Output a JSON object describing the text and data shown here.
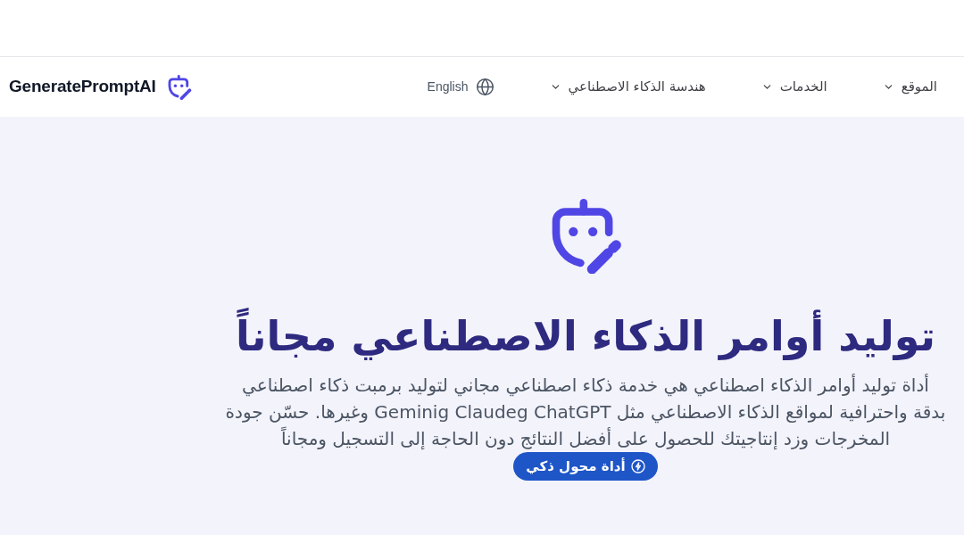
{
  "header": {
    "logo_text": "GeneratePromptAI",
    "language": {
      "label": "English"
    },
    "nav_items": [
      {
        "label": "الموقع"
      },
      {
        "label": "الخدمات"
      },
      {
        "label": "هندسة الذكاء الاصطناعي"
      }
    ]
  },
  "hero": {
    "title": "توليد أوامر الذكاء الاصطناعي مجاناً",
    "description": "أداة توليد أوامر الذكاء اصطناعي هي خدمة ذكاء اصطناعي مجاني لتوليد برمبت ذكاء اصطناعي بدقة واحترافية لمواقع الذكاء الاصطناعي مثل Geminig Claudeg ChatGPT وغيرها. حسّن جودة المخرجات وزد إنتاجيتك للحصول على أفضل النتائج دون الحاجة إلى التسجيل ومجاناً",
    "button": {
      "label": "أداة محول ذكي"
    }
  }
}
